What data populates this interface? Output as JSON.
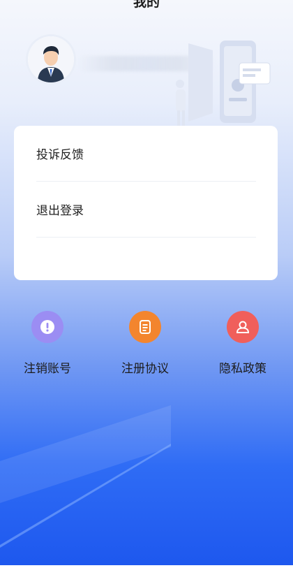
{
  "page_title": "我的",
  "menu": [
    {
      "label": "投诉反馈"
    },
    {
      "label": "退出登录"
    }
  ],
  "quick_actions": [
    {
      "label": "注销账号",
      "icon": "alert-icon",
      "color": "#9b8df3"
    },
    {
      "label": "注册协议",
      "icon": "document-icon",
      "color": "#f3852e"
    },
    {
      "label": "隐私政策",
      "icon": "user-icon",
      "color": "#f05f5b"
    }
  ]
}
